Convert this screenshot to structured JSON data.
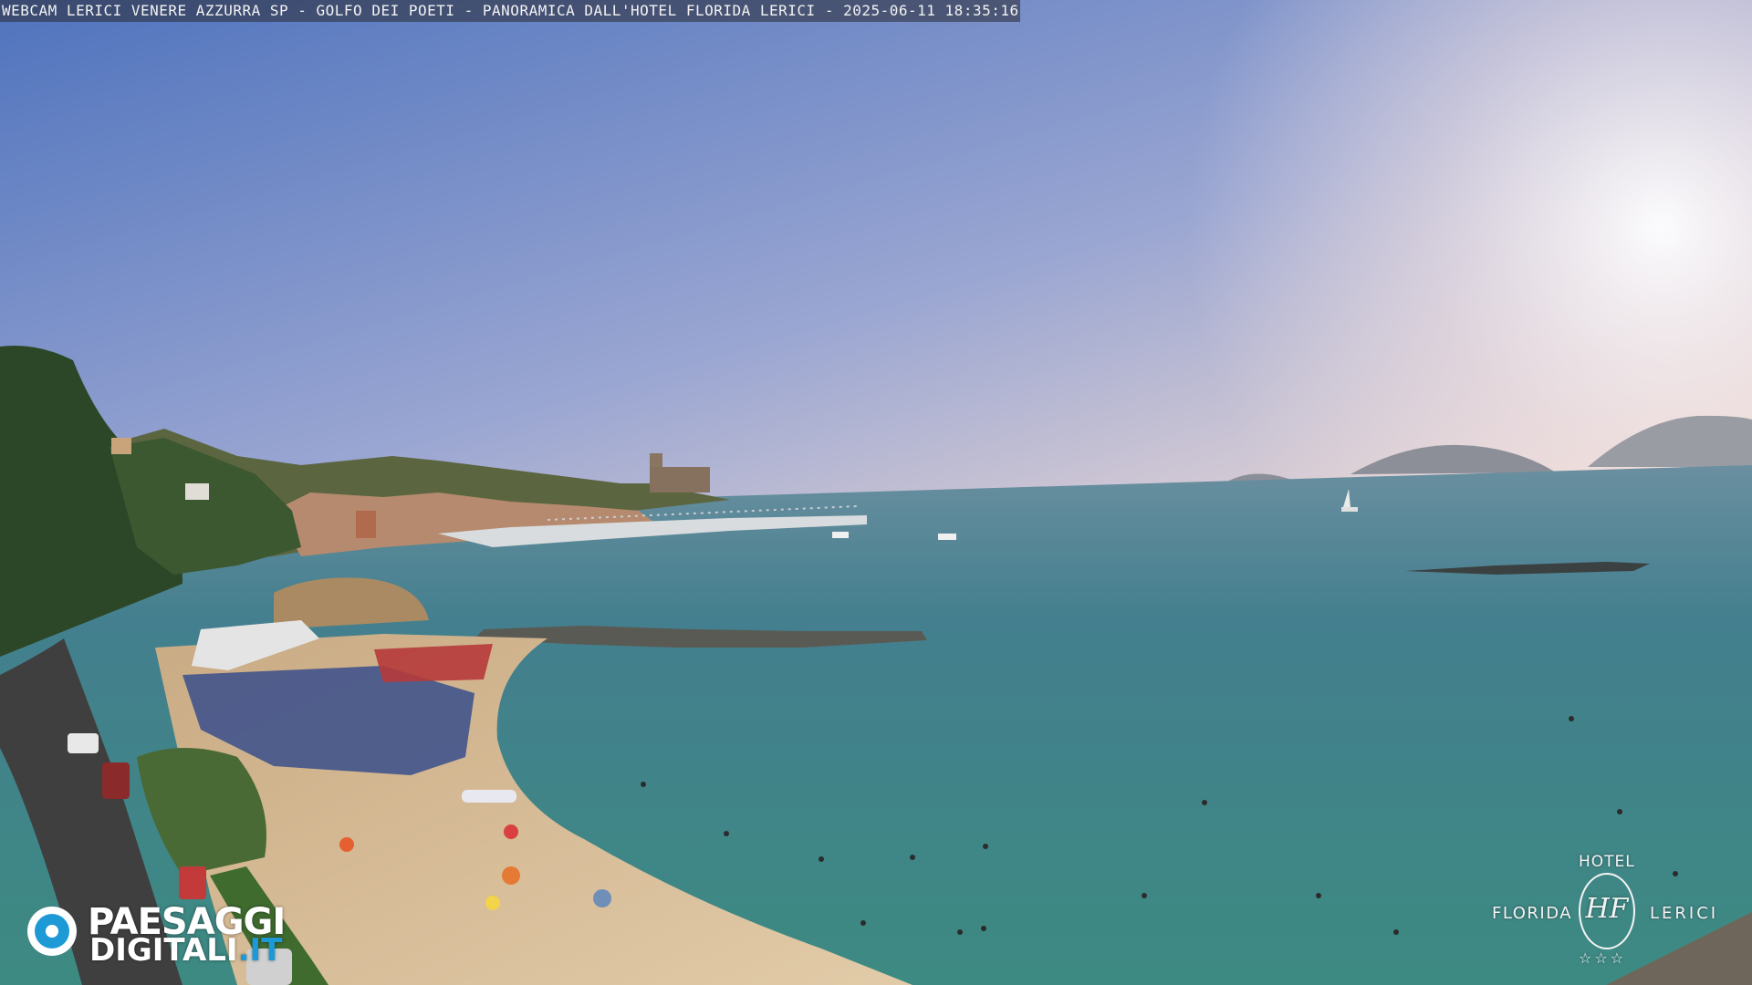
{
  "overlay": {
    "caption": "WEBCAM LERICI VENERE AZZURRA SP - GOLFO DEI POETI - PANORAMICA DALL'HOTEL FLORIDA LERICI - 2025-06-11 18:35:16"
  },
  "logo_left": {
    "line1": "PAESAGGI",
    "line2_main": "DIGITALI",
    "line2_accent": ".IT",
    "icon": "eye-icon",
    "accent_color": "#1d9ad6"
  },
  "hotel_logo": {
    "top": "HOTEL",
    "left": "FLORIDA",
    "right": "LERICI",
    "monogram": "HF",
    "stars": "☆☆☆"
  },
  "colors": {
    "sky_top": "#5d7fc0",
    "sky_horizon": "#f2d9d0",
    "sea": "#3e7d86",
    "sand": "#d9c09b",
    "vegetation": "#2f4a28"
  }
}
